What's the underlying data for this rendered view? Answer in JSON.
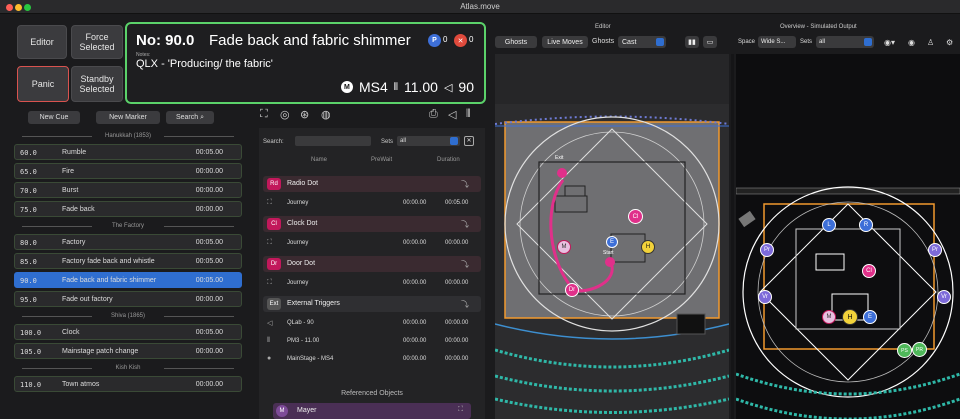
{
  "window": {
    "title": "Atlas.move"
  },
  "controls": {
    "editor": "Editor",
    "force_selected": "Force\nSelected",
    "panic": "Panic",
    "standby_selected": "Standby\nSelected"
  },
  "current_cue": {
    "number_label": "No: 90.0",
    "name": "Fade back and fabric shimmer",
    "notes_label": "Notes:",
    "notes": "QLX - 'Producing/ the fabric'",
    "badge_p_count": "0",
    "badge_x_count": "0",
    "stage": "MS4",
    "level": "11.00",
    "volume": "90"
  },
  "list_toolbar": {
    "new_cue": "New Cue",
    "new_marker": "New Marker",
    "search": "Search"
  },
  "cue_groups": [
    {
      "header": "Hanukkah (1853)",
      "cues": [
        {
          "num": "60.0",
          "name": "Rumble",
          "time": "00:05.00"
        },
        {
          "num": "65.0",
          "name": "Fire",
          "time": "00:00.00"
        },
        {
          "num": "70.0",
          "name": "Burst",
          "time": "00:00.00"
        },
        {
          "num": "75.0",
          "name": "Fade back",
          "time": "00:00.00"
        }
      ]
    },
    {
      "header": "The Factory",
      "cues": [
        {
          "num": "80.0",
          "name": "Factory",
          "time": "00:05.00"
        },
        {
          "num": "85.0",
          "name": "Factory fade back and whistle",
          "time": "00:05.00"
        },
        {
          "num": "90.0",
          "name": "Fade back and fabric shimmer",
          "time": "00:05.00",
          "selected": true
        },
        {
          "num": "95.0",
          "name": "Fade out factory",
          "time": "00:00.00"
        }
      ]
    },
    {
      "header": "Shiva (1865)",
      "cues": [
        {
          "num": "100.0",
          "name": "Clock",
          "time": "00:05.00"
        },
        {
          "num": "105.0",
          "name": "Mainstage patch change",
          "time": "00:00.00"
        }
      ]
    },
    {
      "header": "Kish Kish",
      "cues": [
        {
          "num": "110.0",
          "name": "Town atmos",
          "time": "00:00.00"
        }
      ]
    }
  ],
  "objects_panel": {
    "search_label": "Search:",
    "sets_label": "Sets",
    "sets_value": "all",
    "col_name": "Name",
    "col_prewait": "PreWait",
    "col_duration": "Duration",
    "objects": [
      {
        "tag": "Rd",
        "name": "Radio Dot",
        "color": "#c2185b",
        "sub": {
          "name": "Journey",
          "prewait": "00:00.00",
          "duration": "00:05.00"
        }
      },
      {
        "tag": "Cl",
        "name": "Clock Dot",
        "color": "#c2185b",
        "sub": {
          "name": "Journey",
          "prewait": "00:00.00",
          "duration": "00:00.00"
        }
      },
      {
        "tag": "Dr",
        "name": "Door Dot",
        "color": "#c2185b",
        "sub": {
          "name": "Journey",
          "prewait": "00:00.00",
          "duration": "00:00.00"
        }
      }
    ],
    "external": {
      "tag": "Ext",
      "name": "External Triggers",
      "subs": [
        {
          "name": "QLab - 90",
          "prewait": "00:00.00",
          "duration": "00:00.00"
        },
        {
          "name": "PM3 - 11.00",
          "prewait": "00:00.00",
          "duration": "00:00.00"
        },
        {
          "name": "MainStage - MS4",
          "prewait": "00:00.00",
          "duration": "00:00.00"
        }
      ]
    },
    "referenced_header": "Referenced Objects",
    "referenced": {
      "tag": "M",
      "name": "Mayer"
    }
  },
  "editor": {
    "title": "Editor",
    "ghosts_btn": "Ghosts",
    "live_moves_btn": "Live Moves",
    "ghosts_label": "Ghosts",
    "ghosts_value": "Cast",
    "markers": {
      "exit": "Exit",
      "start": "Start",
      "cl": "Cl",
      "m": "M",
      "e": "E",
      "h": "H",
      "dr": "Dr"
    }
  },
  "overview": {
    "title": "Overview - Simulated Output",
    "space_label": "Space",
    "space_value": "Wide S...",
    "sets_label": "Sets",
    "sets_value": "all",
    "markers": {
      "l": "L",
      "r": "R",
      "pr1": "Pr",
      "pr2": "Pr",
      "cl": "Cl",
      "vr1": "Vr",
      "vr2": "Vr",
      "m": "M",
      "h": "H",
      "e": "E",
      "ps": "PS",
      "pr3": "PR"
    }
  },
  "colors": {
    "accent": "#2f6ed0",
    "cue_border": "#5bd26a",
    "panic": "#d9534f",
    "dot": "#e0308a",
    "yellow": "#f2d23a",
    "blue": "#3d6fd8",
    "purple": "#7d6ad9",
    "green": "#4fb85a"
  }
}
